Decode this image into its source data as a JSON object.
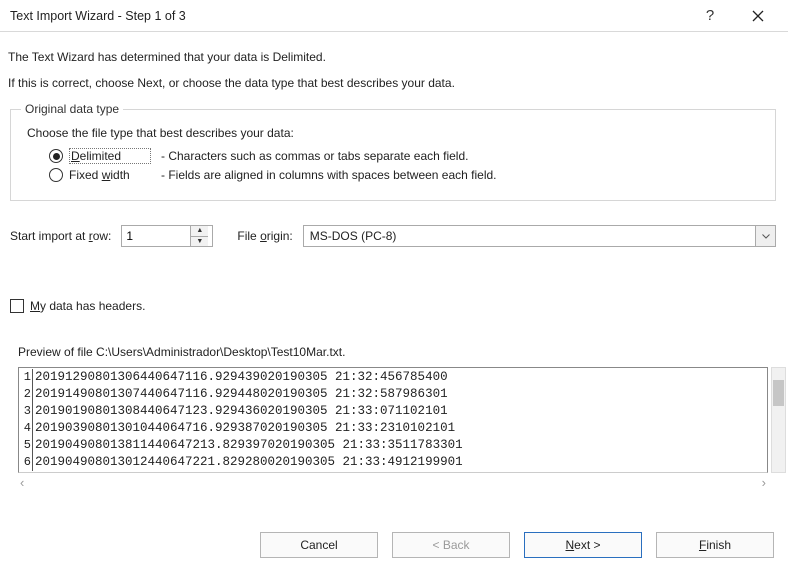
{
  "title": "Text Import Wizard - Step 1 of 3",
  "intro1": "The Text Wizard has determined that your data is Delimited.",
  "intro2": "If this is correct, choose Next, or choose the data type that best describes your data.",
  "groupbox": {
    "legend": "Original data type",
    "choose": "Choose the file type that best describes your data:",
    "delimited": {
      "label_pre": "D",
      "label_post": "elimited",
      "desc": "- Characters such as commas or tabs separate each field."
    },
    "fixed": {
      "label_pre": "Fixed ",
      "label_u": "w",
      "label_post": "idth",
      "desc": "- Fields are aligned in columns with spaces between each field."
    }
  },
  "import_row": {
    "label_pre": "Start import at ",
    "label_u": "r",
    "label_post": "ow:",
    "value": "1",
    "origin_label_pre": "File ",
    "origin_label_u": "o",
    "origin_label_post": "rigin:",
    "origin_value": "MS-DOS (PC-8)"
  },
  "headers_check": {
    "pre": "",
    "u": "M",
    "post": "y data has headers."
  },
  "preview": {
    "label": "Preview of file C:\\Users\\Administrador\\Desktop\\Test10Mar.txt.",
    "lines": [
      {
        "n": "1",
        "t": "201912908013064406471169294390201903052132456785400"
      },
      {
        "n": "2",
        "t": "201914908013074406471169294480201903052132587986301"
      },
      {
        "n": "3",
        "t": "201901908013084406471239294360201903052133071102101"
      },
      {
        "n": "4",
        "t": "201903908013010440647169293870201903052133:2310102101"
      },
      {
        "n": "5",
        "t": "2019049080138114406472138293970201903052133:3511783301"
      },
      {
        "n": "6",
        "t": "2019049080130124406472218292800201903052133:4912199901"
      }
    ]
  },
  "buttons": {
    "cancel": "Cancel",
    "back": "< Back",
    "next_pre": "",
    "next_u": "N",
    "next_post": "ext >",
    "finish_pre": "",
    "finish_u": "F",
    "finish_post": "inish"
  }
}
